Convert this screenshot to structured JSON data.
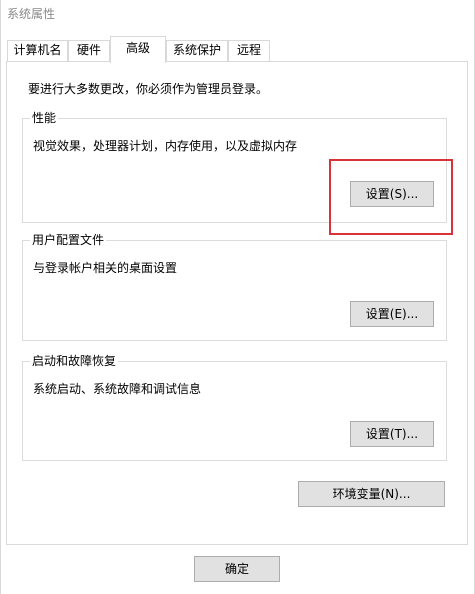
{
  "window": {
    "title": "系统属性"
  },
  "tabs": [
    {
      "label": "计算机名"
    },
    {
      "label": "硬件"
    },
    {
      "label": "高级",
      "active": true
    },
    {
      "label": "系统保护"
    },
    {
      "label": "远程"
    }
  ],
  "admin_note": "要进行大多数更改，你必须作为管理员登录。",
  "performance": {
    "title": "性能",
    "description": "视觉效果，处理器计划，内存使用，以及虚拟内存",
    "settings_label": "设置(S)..."
  },
  "user_profiles": {
    "title": "用户配置文件",
    "description": "与登录帐户相关的桌面设置",
    "settings_label": "设置(E)..."
  },
  "startup_recovery": {
    "title": "启动和故障恢复",
    "description": "系统启动、系统故障和调试信息",
    "settings_label": "设置(T)..."
  },
  "env_vars_label": "环境变量(N)...",
  "ok_label": "确定",
  "colors": {
    "highlight": "#d9333a",
    "button_face": "#e1e1e1",
    "button_border": "#adadad"
  }
}
